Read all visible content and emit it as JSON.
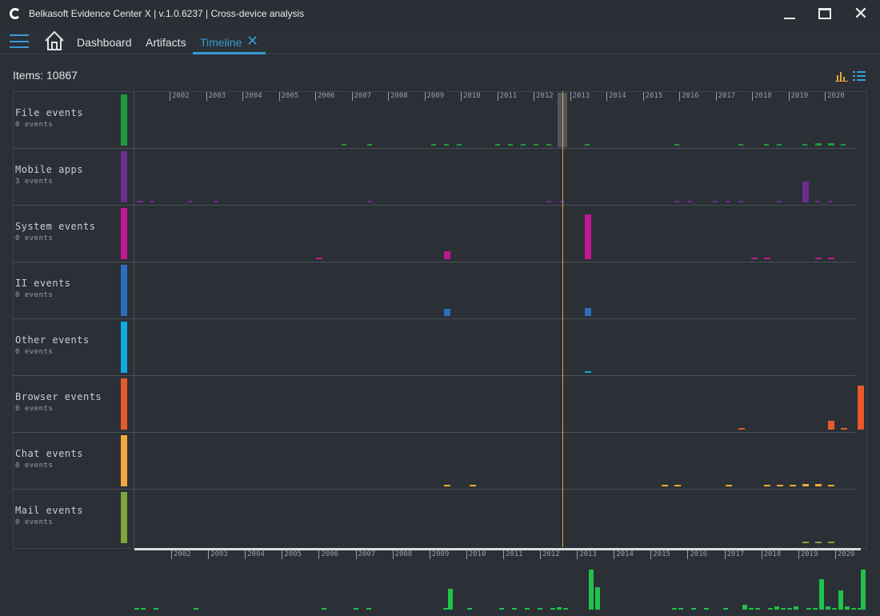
{
  "window": {
    "title": "Belkasoft Evidence Center X | v.1.0.6237 | Cross-device analysis"
  },
  "nav": {
    "tabs": [
      {
        "label": "Dashboard"
      },
      {
        "label": "Artifacts"
      },
      {
        "label": "Timeline"
      }
    ]
  },
  "summary": {
    "items_label": "Items: 10867"
  },
  "timeline": {
    "years": [
      "2002",
      "2003",
      "2004",
      "2005",
      "2006",
      "2007",
      "2008",
      "2009",
      "2010",
      "2011",
      "2012",
      "2013",
      "2014",
      "2015",
      "2016",
      "2017",
      "2018",
      "2019",
      "2020"
    ],
    "rows": [
      {
        "name": "File events",
        "count": "0 events",
        "color": "#1e9a3c"
      },
      {
        "name": "Mobile apps",
        "count": "3 events",
        "color": "#6b2e8f"
      },
      {
        "name": "System events",
        "count": "0 events",
        "color": "#c2188f"
      },
      {
        "name": "II events",
        "count": "0 events",
        "color": "#2a6fbf"
      },
      {
        "name": "Other events",
        "count": "0 events",
        "color": "#10a9e0"
      },
      {
        "name": "Browser events",
        "count": "0 events",
        "color": "#e85a2a"
      },
      {
        "name": "Chat events",
        "count": "0 events",
        "color": "#f4a93a"
      },
      {
        "name": "Mail events",
        "count": "0 events",
        "color": "#7fa83a"
      }
    ]
  },
  "colors": {
    "accent": "#3a9bd6",
    "cursor": "#e8a33b",
    "overview": "#1fc24a"
  },
  "icons": {
    "app": "belkasoft-logo-icon",
    "menu": "hamburger-icon",
    "home": "home-icon",
    "close_tab": "close-icon",
    "chart_view": "bar-chart-icon",
    "list_view": "list-icon"
  }
}
